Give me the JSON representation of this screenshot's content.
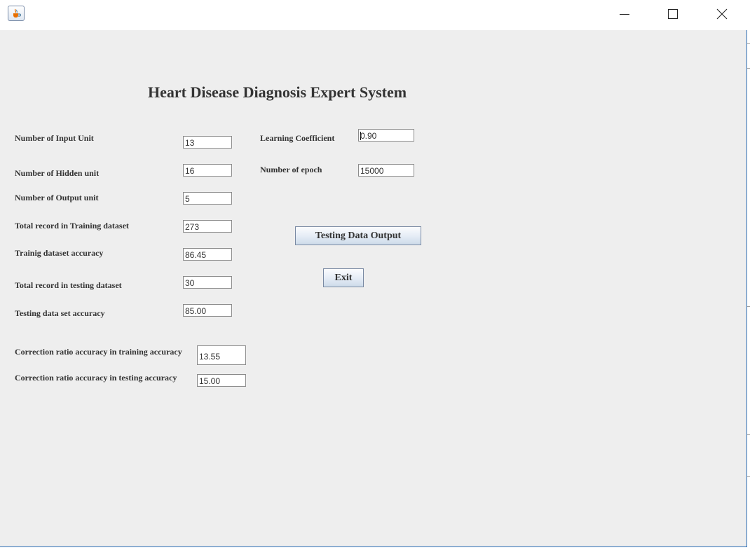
{
  "window": {
    "title": ""
  },
  "main": {
    "title": "Heart Disease Diagnosis Expert System",
    "fields": {
      "input_units": {
        "label": "Number of Input Unit",
        "value": "13"
      },
      "hidden_units": {
        "label": "Number of Hidden unit",
        "value": "16"
      },
      "output_units": {
        "label": "Number of Output unit",
        "value": "5"
      },
      "training_records": {
        "label": "Total record in Training dataset",
        "value": "273"
      },
      "training_accuracy": {
        "label": "Trainig dataset accuracy",
        "value": "86.45"
      },
      "testing_records": {
        "label": "Total  record in testing dataset",
        "value": "30"
      },
      "testing_accuracy": {
        "label": "Testing data set accuracy",
        "value": "85.00"
      },
      "correction_training": {
        "label": "Correction ratio accuracy in training accuracy",
        "value": "13.55"
      },
      "correction_testing": {
        "label": "Correction ratio accuracy in testing accuracy",
        "value": "15.00"
      },
      "learning_coefficient": {
        "label": "Learning Coefficient",
        "value": "0.90"
      },
      "epochs": {
        "label": "Number of epoch",
        "value": "15000"
      }
    },
    "buttons": {
      "testing_output": "Testing Data Output",
      "exit": "Exit"
    }
  },
  "icons": {
    "app": "java-cup-icon",
    "minimize": "minimize-icon",
    "maximize": "maximize-icon",
    "close": "close-icon"
  }
}
